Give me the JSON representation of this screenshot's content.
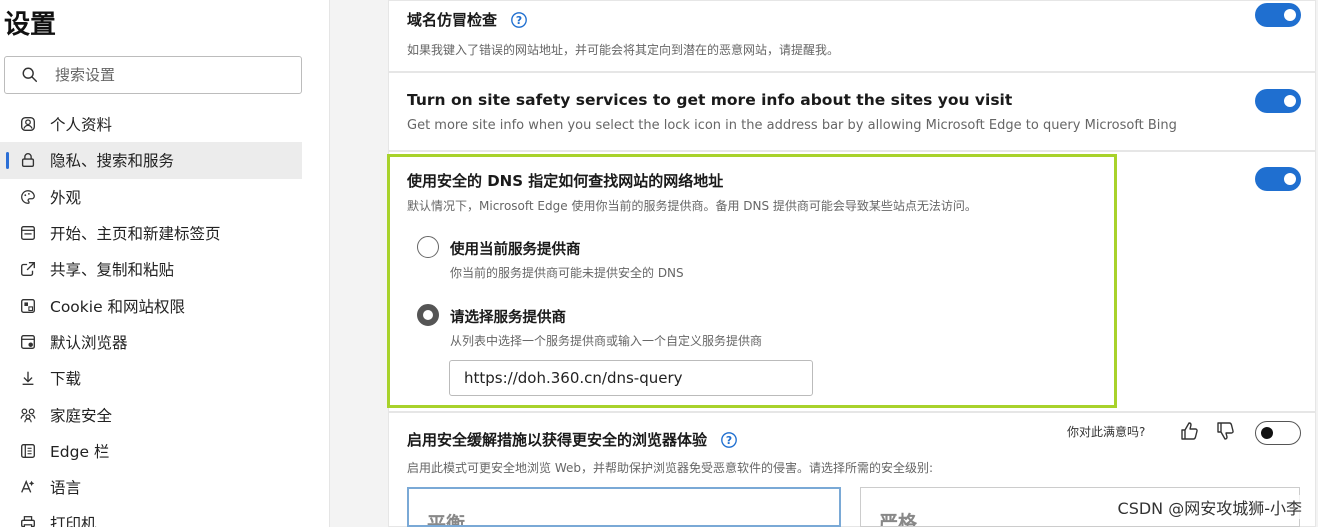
{
  "sidebar": {
    "title": "设置",
    "search_placeholder": "搜索设置",
    "items": [
      {
        "label": "个人资料",
        "icon": "profile-icon"
      },
      {
        "label": "隐私、搜索和服务",
        "icon": "lock-icon",
        "active": true
      },
      {
        "label": "外观",
        "icon": "appearance-icon"
      },
      {
        "label": "开始、主页和新建标签页",
        "icon": "home-tab-icon"
      },
      {
        "label": "共享、复制和粘贴",
        "icon": "share-icon"
      },
      {
        "label": "Cookie 和网站权限",
        "icon": "cookie-permissions-icon"
      },
      {
        "label": "默认浏览器",
        "icon": "default-browser-icon"
      },
      {
        "label": "下载",
        "icon": "download-icon"
      },
      {
        "label": "家庭安全",
        "icon": "family-icon"
      },
      {
        "label": "Edge 栏",
        "icon": "edge-bar-icon"
      },
      {
        "label": "语言",
        "icon": "language-icon"
      },
      {
        "label": "打印机",
        "icon": "printer-icon"
      }
    ]
  },
  "typosquatting": {
    "title": "域名仿冒检查",
    "desc": "如果我键入了错误的网站地址，并可能会将其定向到潜在的恶意网站，请提醒我。",
    "enabled": true
  },
  "site_safety": {
    "title": "Turn on site safety services to get more info about the sites you visit",
    "desc": "Get more site info when you select the lock icon in the address bar by allowing Microsoft Edge to query Microsoft Bing",
    "enabled": true
  },
  "secure_dns": {
    "title": "使用安全的 DNS 指定如何查找网站的网络地址",
    "desc": "默认情况下，Microsoft Edge 使用你当前的服务提供商。备用 DNS 提供商可能会导致某些站点无法访问。",
    "enabled": true,
    "options": [
      {
        "label": "使用当前服务提供商",
        "desc": "你当前的服务提供商可能未提供安全的 DNS",
        "checked": false
      },
      {
        "label": "请选择服务提供商",
        "desc": "从列表中选择一个服务提供商或输入一个自定义服务提供商",
        "checked": true
      }
    ],
    "provider_value": "https://doh.360.cn/dns-query"
  },
  "security_mitigation": {
    "title": "启用安全缓解措施以获得更安全的浏览器体验",
    "desc": "启用此模式可更安全地浏览 Web，并帮助保护浏览器免受恶意软件的侵害。请选择所需的安全级别:",
    "enabled": false,
    "feedback_label": "你对此满意吗?",
    "levels": [
      "平衡",
      "严格"
    ]
  },
  "watermark": "CSDN @网安攻城狮-小李",
  "colors": {
    "accent": "#1f6fd0",
    "highlight_border": "#a8d22b"
  }
}
